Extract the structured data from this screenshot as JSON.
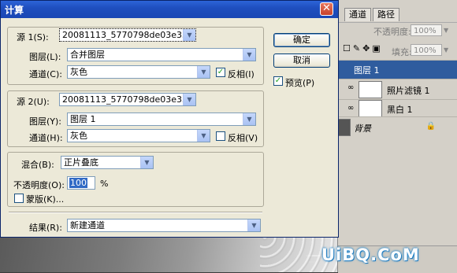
{
  "dialog": {
    "title": "计算",
    "close_glyph": "✕",
    "source1": {
      "label": "源 1(S):",
      "file": "20081113_5770798de03e33...",
      "layer_label": "图层(L):",
      "layer_value": "合并图层",
      "channel_label": "通道(C):",
      "channel_value": "灰色",
      "invert_label": "反相(I)",
      "invert_checked": true
    },
    "source2": {
      "label": "源 2(U):",
      "file": "20081113_5770798de03e33...",
      "layer_label": "图层(Y):",
      "layer_value": "图层 1",
      "channel_label": "通道(H):",
      "channel_value": "灰色",
      "invert_label": "反相(V)",
      "invert_checked": false
    },
    "blending": {
      "label": "混合(B):",
      "mode": "正片叠底",
      "opacity_label": "不透明度(O):",
      "opacity_value": "100",
      "opacity_unit": "%",
      "mask_label": "蒙版(K)...",
      "mask_checked": false
    },
    "result": {
      "label": "结果(R):",
      "value": "新建通道"
    },
    "buttons": {
      "ok": "确定",
      "cancel": "取消"
    },
    "preview": {
      "label": "预览(P)",
      "checked": true
    }
  },
  "layers_panel": {
    "tabs": [
      "通道",
      "路径"
    ],
    "opacity_label": "不透明度:",
    "opacity_value": "100%",
    "fill_label": "填充:",
    "fill_value": "100%",
    "layers": [
      {
        "name": "图层 1",
        "selected": true
      },
      {
        "name": "照片滤镜 1",
        "selected": false
      },
      {
        "name": "黑白 1",
        "selected": false
      },
      {
        "name": "背景",
        "selected": false
      }
    ]
  },
  "watermark": "UiBQ.CoM",
  "colors": {
    "titlebar": "#1f4fbf",
    "selection": "#2f5c9e",
    "dialog_bg": "#ece9d8"
  }
}
